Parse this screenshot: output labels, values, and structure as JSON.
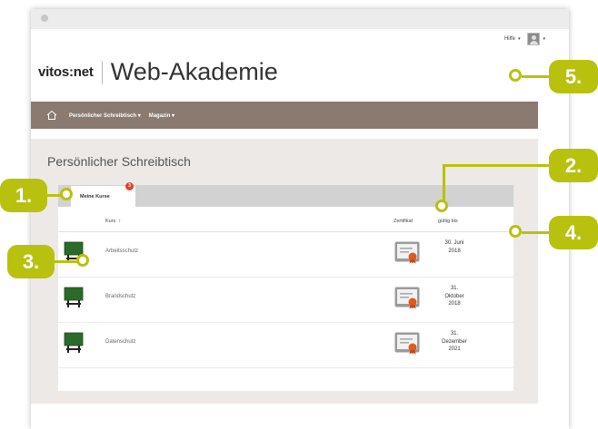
{
  "header": {
    "help_label": "Hilfe",
    "brand_logo": "vitos:net",
    "brand_title": "Web-Akademie"
  },
  "nav": {
    "items": [
      {
        "label": "Persönlicher Schreibtisch ▾"
      },
      {
        "label": "Magazin ▾"
      }
    ]
  },
  "page": {
    "title": "Persönlicher Schreibtisch"
  },
  "tabs": [
    {
      "label": "Meine Kurse",
      "badge": "3"
    }
  ],
  "table": {
    "col_course": "Kurs",
    "col_course_sort": "↑",
    "col_certificate": "Zertifikat",
    "col_valid_until": "gültig bis",
    "rows": [
      {
        "course": "Arbeitsschutz",
        "valid_until": [
          "30. Juni",
          "2018"
        ]
      },
      {
        "course": "Brandschutz",
        "valid_until": [
          "31.",
          "Oktober",
          "2018"
        ]
      },
      {
        "course": "Datenschutz",
        "valid_until": [
          "31.",
          "Dezember",
          "2021"
        ]
      }
    ]
  },
  "callouts": {
    "c1": "1.",
    "c2": "2.",
    "c3": "3.",
    "c4": "4.",
    "c5": "5."
  },
  "colors": {
    "accent_callout": "#b9c10f",
    "navbar": "#8a7a70",
    "board_green": "#2b6a2a",
    "badge_red": "#e0432b"
  },
  "icons": {
    "course_icon": "chalkboard-icon",
    "certificate_icon": "certificate-icon",
    "home_icon": "home-icon",
    "user_icon": "avatar-icon"
  }
}
